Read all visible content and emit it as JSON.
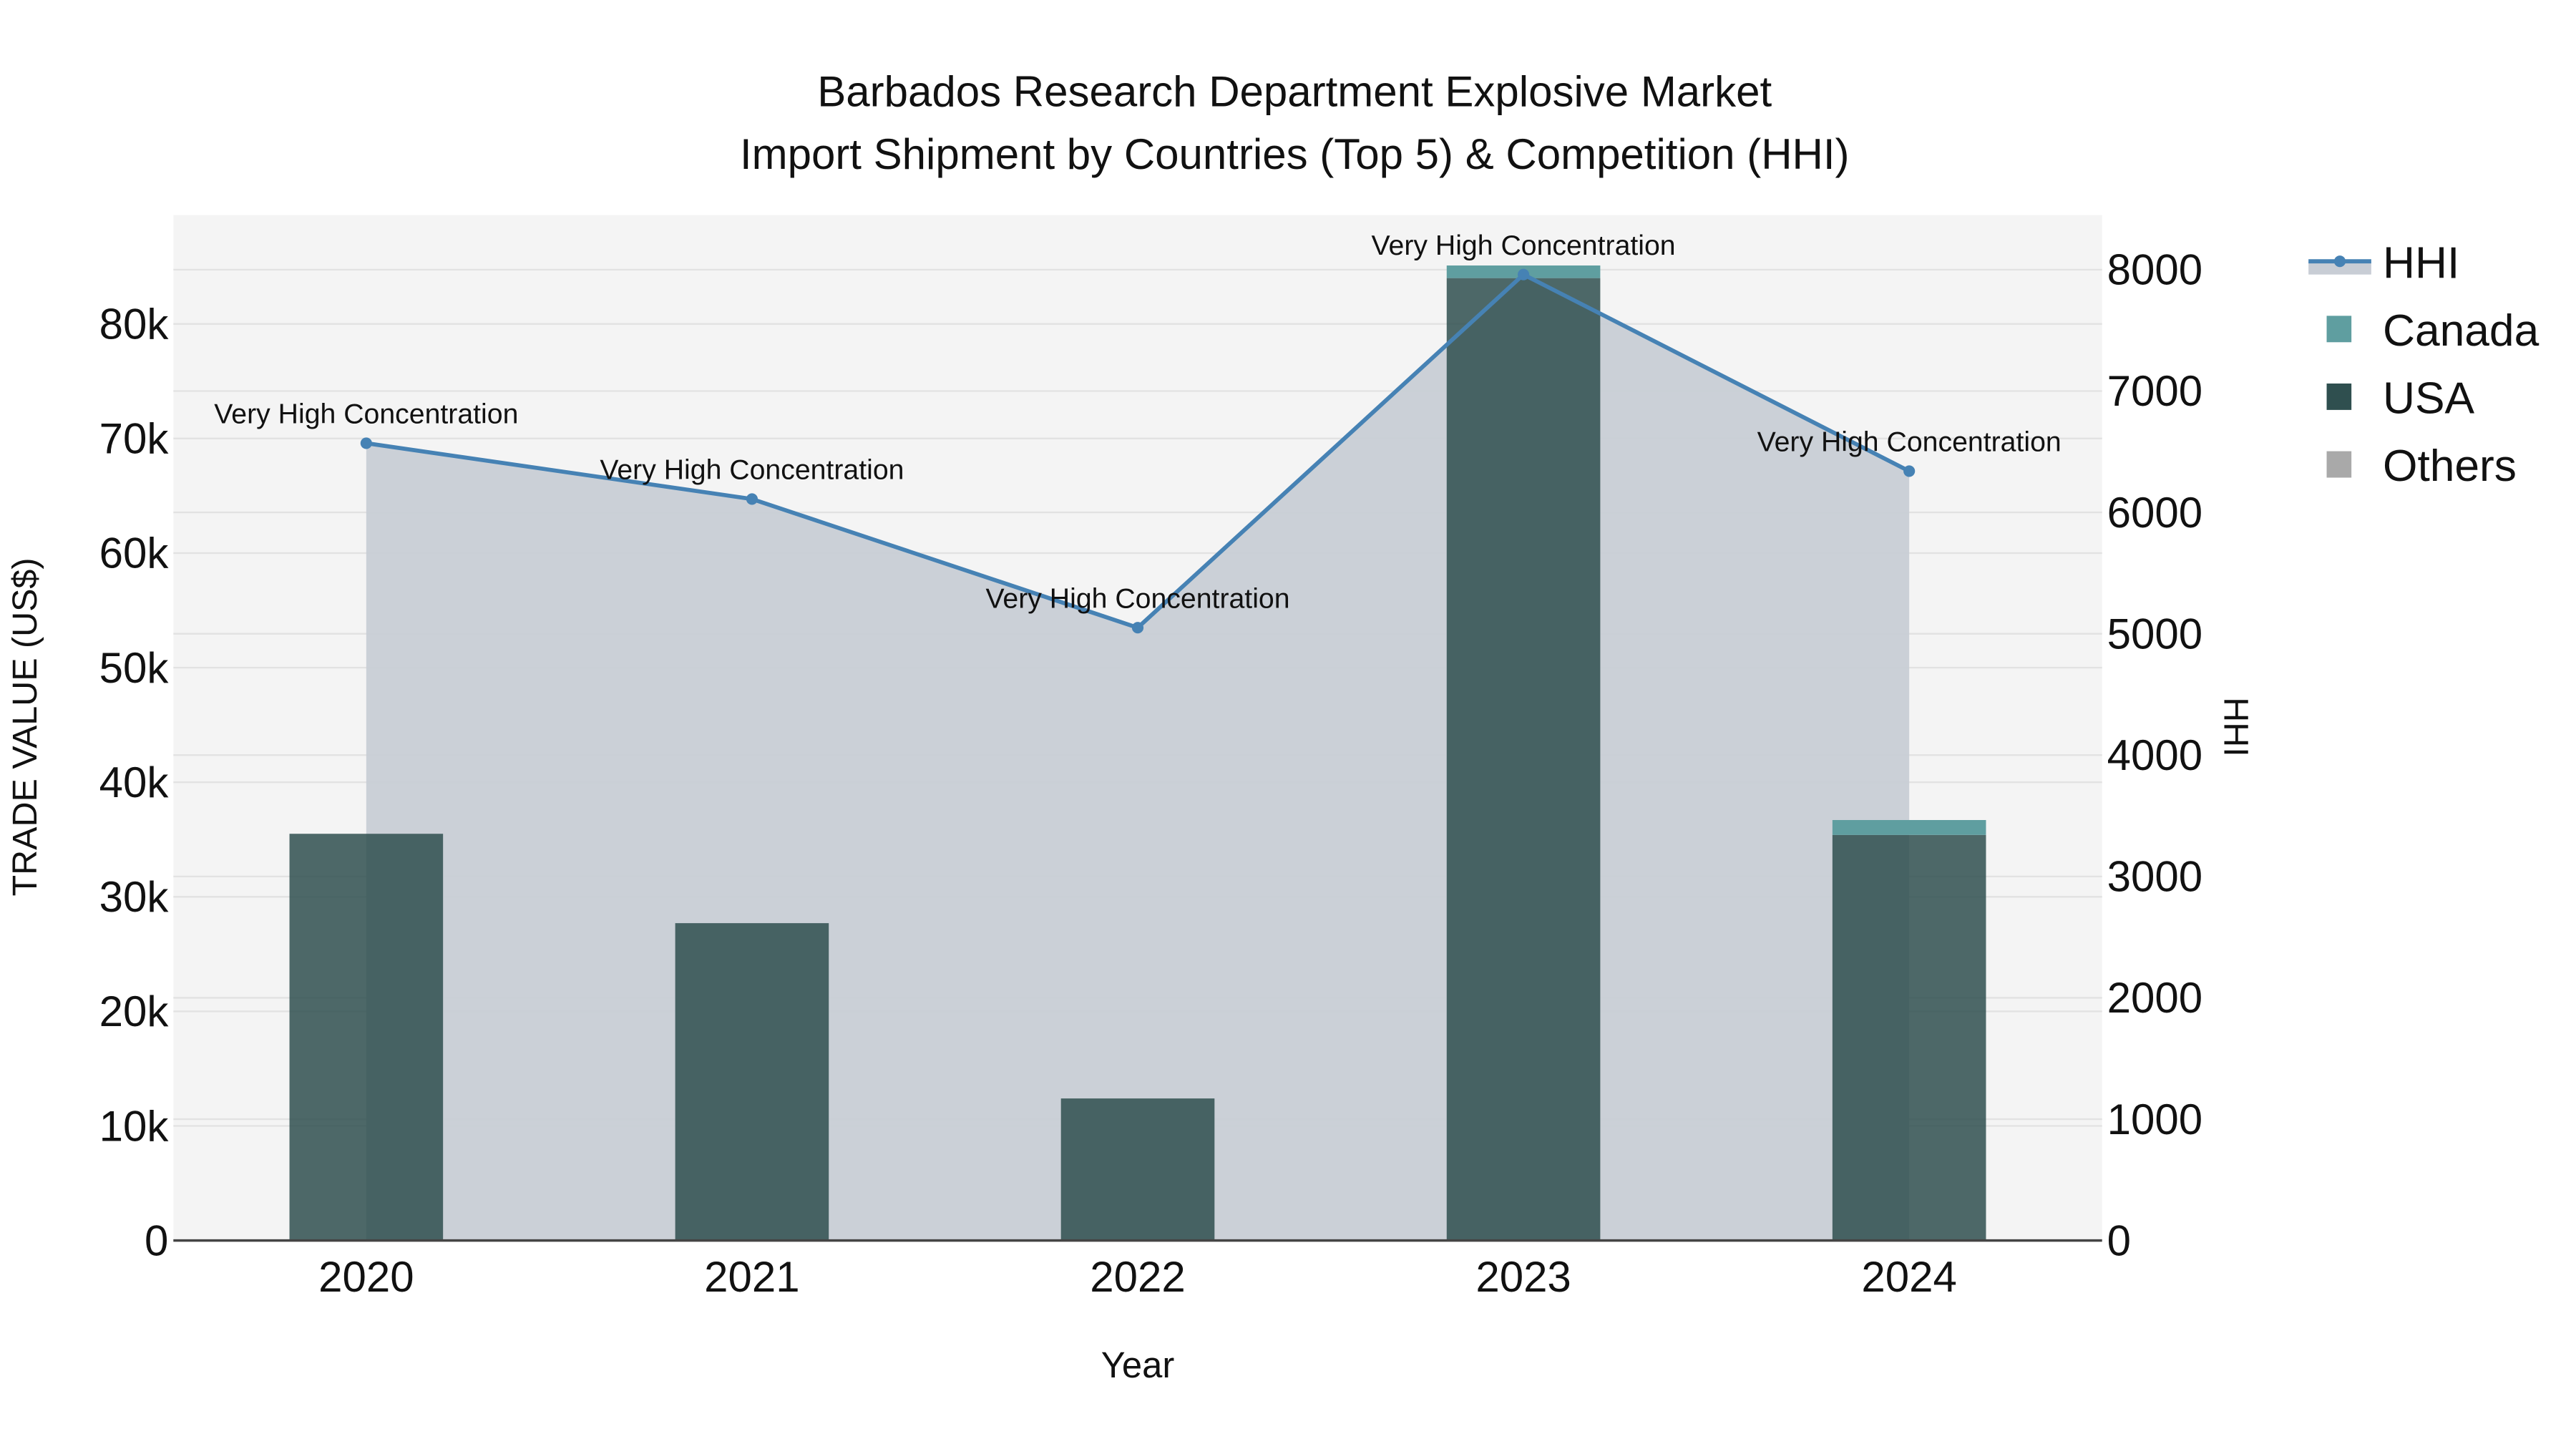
{
  "chart_data": {
    "type": "bar",
    "title_line1": "Barbados Research Department Explosive Market",
    "title_line2": "Import Shipment by Countries (Top 5) & Competition (HHI)",
    "xlabel": "Year",
    "ylabel": "TRADE VALUE (US$)",
    "y2label": "HHI",
    "categories": [
      "2020",
      "2021",
      "2022",
      "2023",
      "2024"
    ],
    "ylim": [
      0,
      89500
    ],
    "y2lim": [
      0,
      8450
    ],
    "yticks": [
      0,
      10000,
      20000,
      30000,
      40000,
      50000,
      60000,
      70000,
      80000
    ],
    "ytick_labels": [
      "0",
      "10k",
      "20k",
      "30k",
      "40k",
      "50k",
      "60k",
      "70k",
      "80k"
    ],
    "y2ticks": [
      0,
      1000,
      2000,
      3000,
      4000,
      5000,
      6000,
      7000,
      8000
    ],
    "y2tick_labels": [
      "0",
      "1000",
      "2000",
      "3000",
      "4000",
      "5000",
      "6000",
      "7000",
      "8000"
    ],
    "series": [
      {
        "name": "USA",
        "color": "#2f4f4f",
        "values": [
          35500,
          27700,
          12400,
          84000,
          35400
        ]
      },
      {
        "name": "Canada",
        "color": "#5f9ea0",
        "values": [
          0,
          0,
          0,
          1100,
          1300
        ]
      },
      {
        "name": "Others",
        "color": "#a9a9a9",
        "values": [
          0,
          0,
          0,
          0,
          0
        ]
      }
    ],
    "hhi": {
      "name": "HHI",
      "color": "#4682b4",
      "fill": "#c8cdd5",
      "values": [
        6570,
        6110,
        5050,
        7960,
        6340
      ],
      "annotations": [
        "Very High Concentration",
        "Very High Concentration",
        "Very High Concentration",
        "Very High Concentration",
        "Very High Concentration"
      ]
    },
    "legend": [
      "HHI",
      "Canada",
      "USA",
      "Others"
    ],
    "legend_position": "top-right",
    "grid": true,
    "plot_bg": "#f4f4f4"
  }
}
